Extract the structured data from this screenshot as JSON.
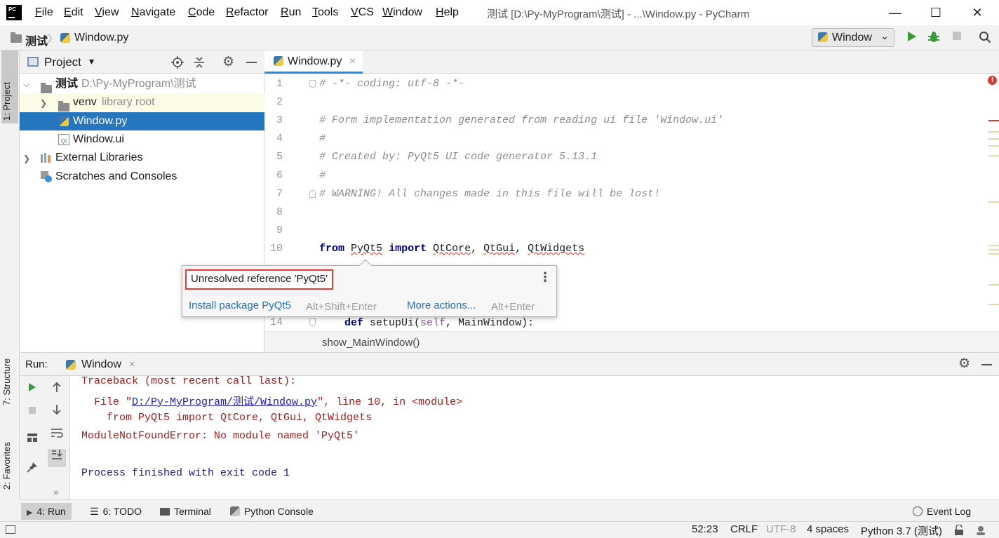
{
  "titlebar": {
    "logo_text": "PC",
    "menu": [
      "File",
      "Edit",
      "View",
      "Navigate",
      "Code",
      "Refactor",
      "Run",
      "Tools",
      "VCS",
      "Window",
      "Help"
    ],
    "window_title": "测试 [D:\\Py-MyProgram\\测试] - ...\\Window.py - PyCharm",
    "minimize": "—",
    "maximize": "☐",
    "close": "✕"
  },
  "navbar": {
    "breadcrumb": [
      "测试",
      "Window.py"
    ],
    "separator": "〉",
    "run_config": "Window",
    "run_config_arrow": "⌄"
  },
  "left_stripe": {
    "project_tab": "1: Project",
    "structure_tab": "7: Structure",
    "favorites_tab": "2: Favorites"
  },
  "project": {
    "title": "Project",
    "title_arrow": "▾",
    "tree": [
      {
        "label": "测试",
        "hint": "D:\\Py-MyProgram\\测试",
        "icon": "folder-icon",
        "expanded": true
      },
      {
        "label": "venv",
        "hint": "library root",
        "icon": "folder-icon",
        "expanded": false
      },
      {
        "label": "Window.py",
        "hint": "",
        "icon": "python-file-icon",
        "selected": true
      },
      {
        "label": "Window.ui",
        "hint": "",
        "icon": "qt-file-icon"
      },
      {
        "label": "External Libraries",
        "hint": "",
        "icon": "libraries-icon",
        "expanded": false
      },
      {
        "label": "Scratches and Consoles",
        "hint": "",
        "icon": "scratches-icon"
      }
    ]
  },
  "editor": {
    "tab_label": "Window.py",
    "tab_close": "×",
    "line_numbers": [
      "1",
      "2",
      "3",
      "4",
      "5",
      "6",
      "7",
      "8",
      "9",
      "10",
      "14"
    ],
    "lines": {
      "l1": "# -*- coding: utf-8 -*-",
      "l3": "# Form implementation generated from reading ui file 'Window.ui'",
      "l4": "#",
      "l5": "# Created by: PyQt5 UI code generator 5.13.1",
      "l6": "#",
      "l7": "# WARNING! All changes made in this file will be lost!",
      "l10_from": "from",
      "l10_mod": "PyQt5",
      "l10_import": "import",
      "l10_a": "QtCore",
      "l10_sep1": ", ",
      "l10_b": "QtGui",
      "l10_sep2": ", ",
      "l10_c": "QtWidgets",
      "l14_def": "def",
      "l14_name": " setupUi(",
      "l14_self": "self",
      "l14_rest": ", MainWindow):"
    },
    "breadcrumb": "show_MainWindow()",
    "error_indicator": "!"
  },
  "popup": {
    "message": "Unresolved reference 'PyQt5'",
    "primary_action": "Install package PyQt5",
    "primary_shortcut": "Alt+Shift+Enter",
    "more_actions": "More actions...",
    "more_shortcut": "Alt+Enter",
    "menu_icon": "⋮"
  },
  "run": {
    "label": "Run:",
    "tab_label": "Window",
    "tab_close": "×",
    "output": {
      "traceback": "Traceback (most recent call last):",
      "file_prefix": "  File \"",
      "file_link": "D:/Py-MyProgram/测试/Window.py",
      "file_suffix": "\", line 10, in <module>",
      "code_line": "    from PyQt5 import QtCore, QtGui, QtWidgets",
      "error": "ModuleNotFoundError: No module named 'PyQt5'",
      "finished": "Process finished with exit code 1"
    },
    "more": "»"
  },
  "bottom_bar": {
    "run": "4: Run",
    "todo": "6: TODO",
    "terminal": "Terminal",
    "python_console": "Python Console",
    "event_log": "Event Log"
  },
  "status": {
    "position": "52:23",
    "line_sep": "CRLF",
    "encoding": "UTF-8",
    "indent": "4 spaces",
    "interpreter": "Python 3.7 (测试)"
  },
  "colors": {
    "selection": "#2675bf",
    "error_red": "#e03c36",
    "run_green": "#3a9a3a",
    "link_blue": "#2470b3"
  }
}
